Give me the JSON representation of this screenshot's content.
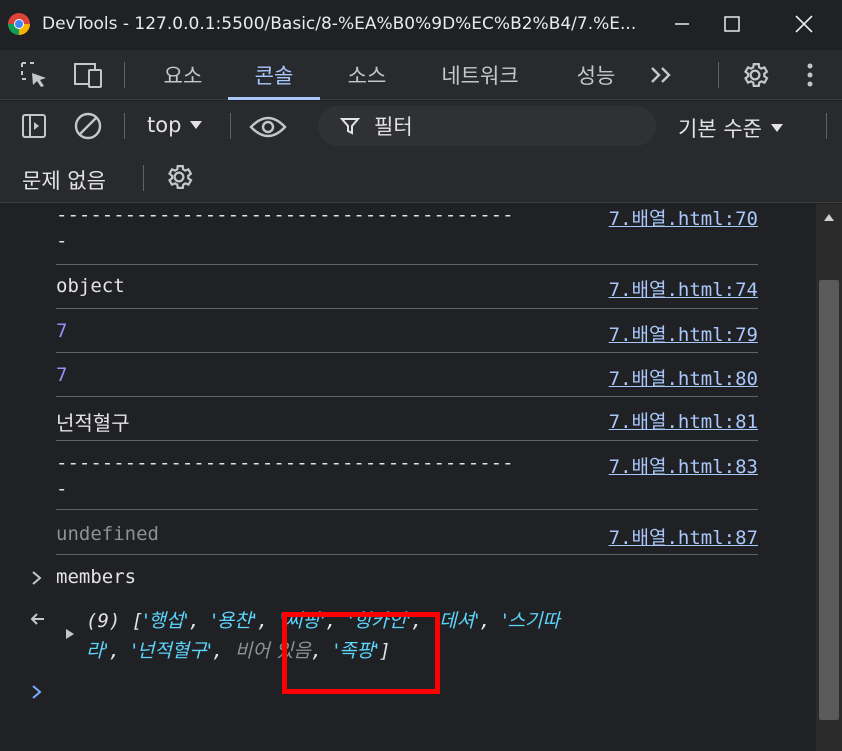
{
  "window": {
    "title": "DevTools - 127.0.0.1:5500/Basic/8-%EA%B0%9D%EC%B2%B4/7.%E..."
  },
  "tabs": [
    {
      "label": "요소",
      "active": false
    },
    {
      "label": "콘솔",
      "active": true
    },
    {
      "label": "소스",
      "active": false
    },
    {
      "label": "네트워크",
      "active": false
    },
    {
      "label": "성능",
      "active": false
    }
  ],
  "toolbar": {
    "context": "top",
    "filter_placeholder": "필터",
    "level": "기본 수준"
  },
  "issues": {
    "label": "문제 없음"
  },
  "console": {
    "messages": [
      {
        "text": "----------------------------------------",
        "text2": "-",
        "source": "7.배열.html:70"
      },
      {
        "text": "object",
        "source": "7.배열.html:74"
      },
      {
        "text": "7",
        "source": "7.배열.html:79"
      },
      {
        "text": "7",
        "source": "7.배열.html:80"
      },
      {
        "text": "넌적혈구",
        "source": "7.배열.html:81"
      },
      {
        "text": "----------------------------------------",
        "text2": "-",
        "source": "7.배열.html:83"
      },
      {
        "text": "undefined",
        "source": "7.배열.html:87"
      }
    ],
    "input_echo": "members",
    "result": {
      "count": "(9)",
      "items_line1": [
        "'행섭'",
        "'용찬'",
        "'씨팡'",
        "'힝카인'",
        "'데셔'",
        "'스기따"
      ],
      "items_line2_start": "라'",
      "items_line2": [
        "'넌적혈구'"
      ],
      "empty_label": "비어 있음",
      "last_item": "'족팡'"
    }
  },
  "colors": {
    "accent": "#a8c7fa",
    "highlight": "#ff0000",
    "string": "#5cd5fb",
    "number": "#9e8cf7"
  }
}
